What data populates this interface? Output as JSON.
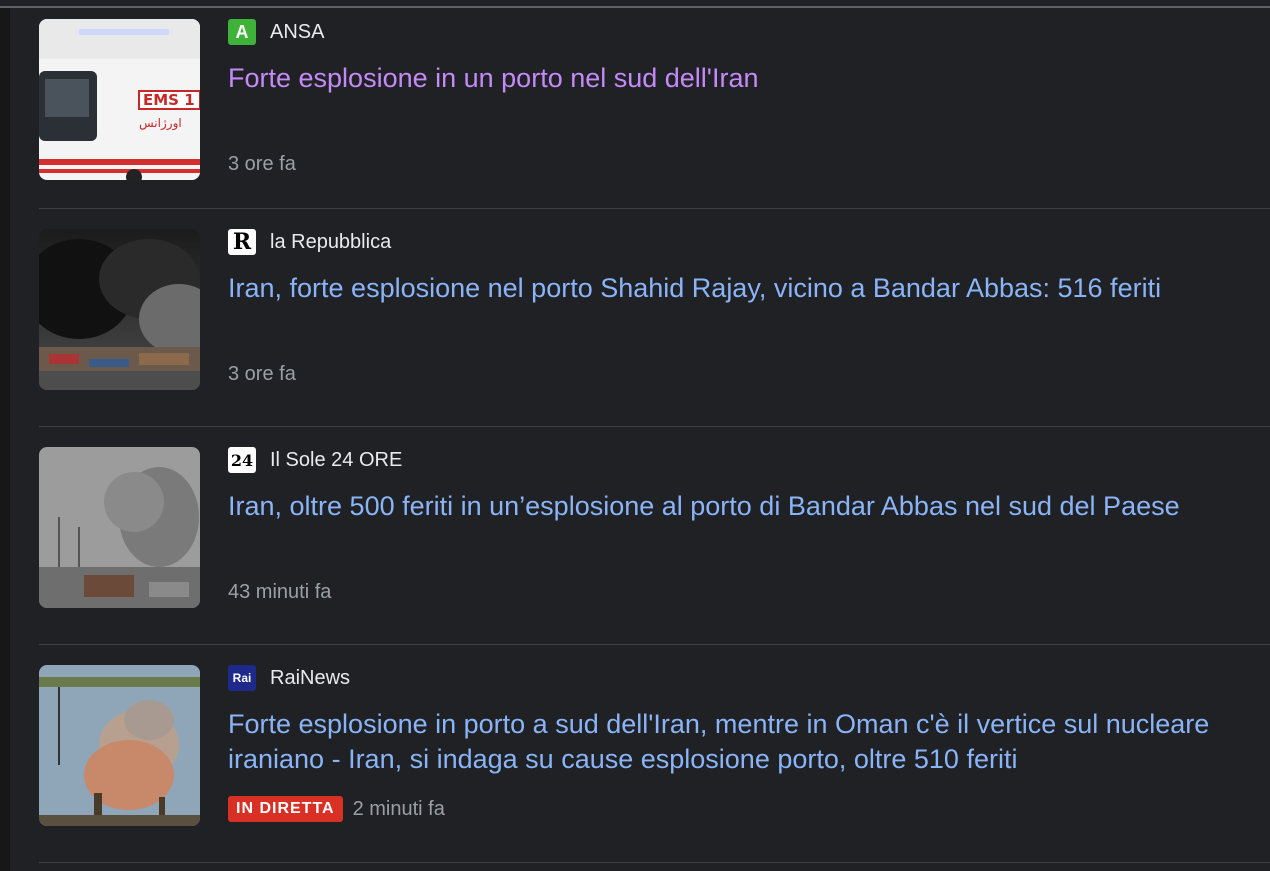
{
  "articles": [
    {
      "source": "ANSA",
      "favicon_text": "A",
      "favicon_color": "#3fb23a",
      "headline": "Forte esplosione in un porto nel sud dell'Iran",
      "visited": true,
      "time": "3 ore fa",
      "live_badge": null,
      "thumb_text": "EMS 1"
    },
    {
      "source": "la Repubblica",
      "favicon_text": "R",
      "favicon_color": "#ffffff",
      "headline": "Iran, forte esplosione nel porto Shahid Rajay, vicino a Bandar Abbas: 516 feriti",
      "visited": false,
      "time": "3 ore fa",
      "live_badge": null
    },
    {
      "source": "Il Sole 24 ORE",
      "favicon_text": "24",
      "favicon_color": "#ffffff",
      "headline": "Iran, oltre 500 feriti in un’esplosione al porto di Bandar Abbas nel sud del Paese",
      "visited": false,
      "time": "43 minuti fa",
      "live_badge": null
    },
    {
      "source": "RaiNews",
      "favicon_text": "Rai",
      "favicon_color": "#1d2a8c",
      "headline": "Forte esplosione in porto a sud dell'Iran, mentre in Oman c'è il vertice sul nucleare iraniano - Iran, si indaga su cause esplosione porto, oltre 510 feriti",
      "visited": false,
      "time": "2 minuti fa",
      "live_badge": "IN DIRETTA"
    }
  ]
}
